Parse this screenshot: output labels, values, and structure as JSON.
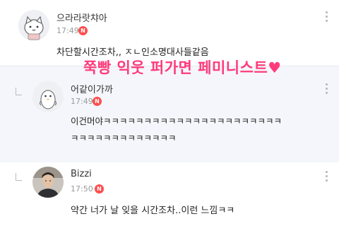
{
  "comments": [
    {
      "author": "으라라랏챠아",
      "time": "17:49",
      "badge": "N",
      "text": "차단할시간조차,, ㅈㄴ인소명대사들같음",
      "avatar_icon": "cat-avatar-icon"
    },
    {
      "author": "어같이가까",
      "time": "17:49",
      "badge": "N",
      "lines": [
        "이건머야ㅋㅋㅋㅋㅋㅋㅋㅋㅋㅋㅋㅋㅋㅋㅋㅋㅋㅋㅋㅋㅋㅋ",
        "ㅋㅋㅋㅋㅋㅋㅋㅋㅋㅋㅋㅋㅋ"
      ],
      "avatar_icon": "penguin-avatar-icon",
      "is_reply": true
    },
    {
      "author": "Bizzi",
      "time": "17:50",
      "badge": "N",
      "text": "약간 너가 날 잊을 시간조차..이런 느낌ㅋㅋ",
      "avatar_icon": "person-photo-avatar",
      "is_reply": true
    }
  ],
  "overlay": {
    "text": "쭉빵 익웃 퍼가면 페미니스트♥",
    "color": "#ff3a7a"
  },
  "colors": {
    "badge": "#ff4d4d",
    "reply_background": "#f4f6fb"
  }
}
